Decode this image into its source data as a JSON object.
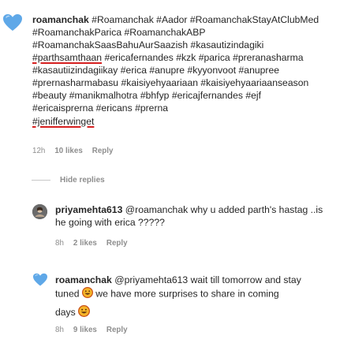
{
  "main_comment": {
    "username": "roamanchak",
    "text_line1": "#Roamanchak #Aador #RoamanchakStayAtClubMed",
    "text_line2": "#RoamanchakParica #RoamanchakABP",
    "text_line3": "#RoamanchakSaasBahuAurSaazish #kasautizindagiki",
    "tag_parth": "#parthsamthaan",
    "text_line4_rest": " #ericafernandes #kzk #parica #preranasharma",
    "text_line5": "#kasautiizindagiikay #erica #anupre #kyyonvoot #anupree",
    "text_line6": "#prernasharmabasu #kaisiyehyaariaan #kaisiyehyaariaanseason",
    "text_line7": "#beauty #manikmalhotra #bhfyp #ericajfernandes #ejf",
    "text_line8": "#ericaisprerna  #ericans #prerna",
    "tag_jeniffer": "#jeniffer­winget",
    "time": "12h",
    "likes": "10 likes",
    "reply": "Reply",
    "avatar_icon": "blue-heart-icon"
  },
  "hide_replies": "Hide replies",
  "replies": [
    {
      "username": "priyamehta613",
      "text_line1": " @roamanchak why u added parth's hastag ..is",
      "text_line2": "he going with erica ?????",
      "time": "8h",
      "likes": "2 likes",
      "reply": "Reply",
      "avatar_icon": "avatar-photo-icon"
    },
    {
      "username": "roamanchak",
      "text_line1": " @priyamehta613 wait till tomorrow and stay",
      "text_line2a": "tuned ",
      "text_line2b": " we have more surprises to share in coming",
      "text_line3a": "days ",
      "time": "8h",
      "likes": "9 likes",
      "reply": "Reply",
      "avatar_icon": "blue-heart-icon",
      "emoji_icon": "grinning-face-emoji-icon"
    }
  ],
  "colors": {
    "heart": "#5fa8e8",
    "username": "#262626",
    "meta": "#8e8e8e",
    "underline": "#d62020"
  }
}
